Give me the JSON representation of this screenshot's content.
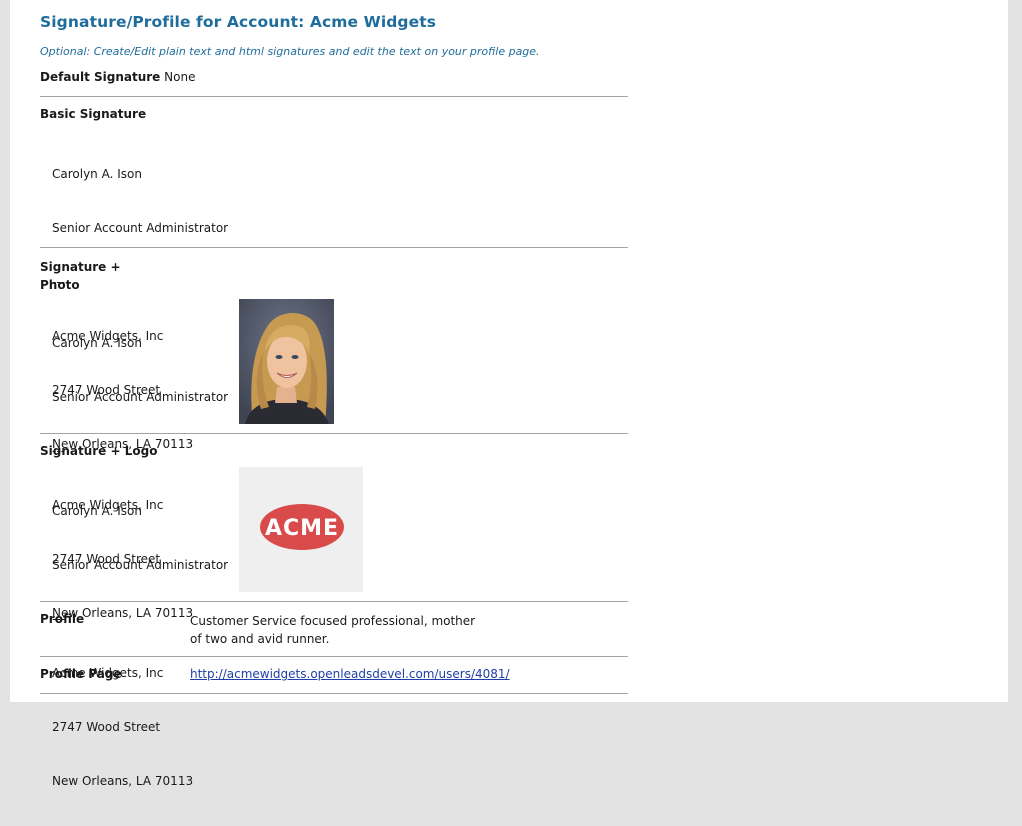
{
  "page": {
    "title": "Signature/Profile for Account: Acme Widgets",
    "subtitle": "Optional: Create/Edit plain text and html signatures and edit the text on your profile page."
  },
  "default_signature": {
    "label": "Default Signature",
    "value": "None"
  },
  "basic_signature": {
    "label": "Basic Signature",
    "lines": [
      "Carolyn A. Ison",
      "Senior Account Administrator",
      "---",
      "Acme Widgets, Inc",
      "2747 Wood Street",
      "New Orleans, LA 70113"
    ]
  },
  "signature_photo": {
    "label_line1": "Signature +",
    "label_line2": "Photo",
    "lines": [
      "Carolyn A. Ison",
      "Senior Account Administrator",
      "---",
      "Acme Widgets, Inc",
      "2747 Wood Street",
      "New Orleans, LA 70113"
    ]
  },
  "signature_logo": {
    "label": "Signature + Logo",
    "lines": [
      "Carolyn A. Ison",
      "Senior Account Administrator",
      "---",
      "Acme Widgets, Inc",
      "2747 Wood Street",
      "New Orleans, LA 70113"
    ],
    "logo_text": "ACME",
    "logo_color": "#d94a4a"
  },
  "profile": {
    "label": "Profile",
    "text_line1": "Customer Service focused professional, mother",
    "text_line2": "of two and avid runner."
  },
  "profile_page": {
    "label": "Profile Page",
    "url": "http://acmewidgets.openleadsdevel.com/users/4081/"
  },
  "colors": {
    "heading": "#1f6d9c",
    "link": "#1e3fa8",
    "background": "#e3e3e3"
  }
}
